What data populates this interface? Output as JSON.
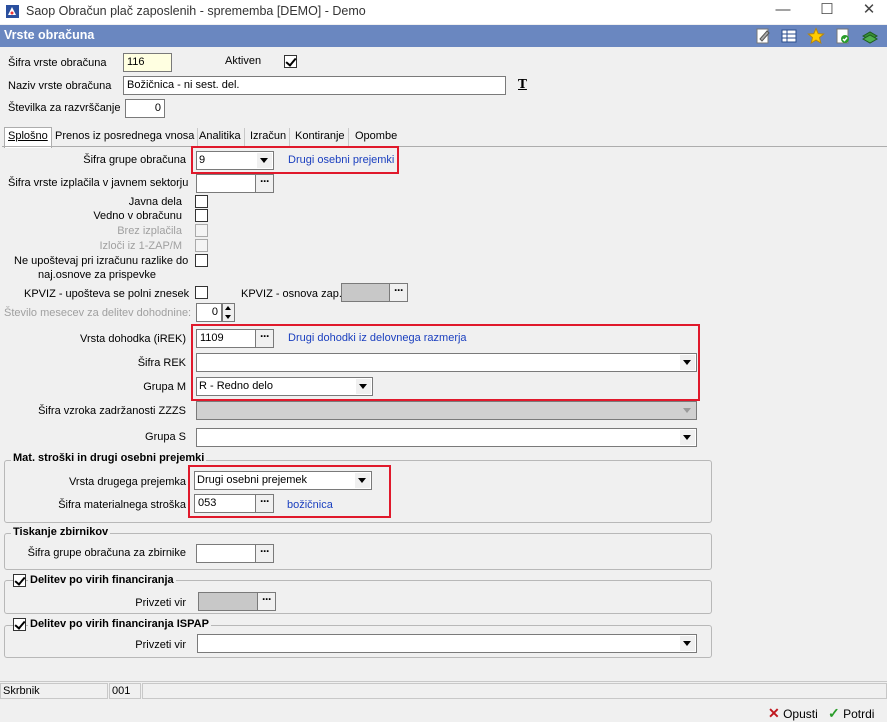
{
  "window": {
    "title": "Saop Obračun plač zaposlenih - sprememba [DEMO] - Demo",
    "min": "—",
    "max": "☐",
    "close": "✕"
  },
  "header": {
    "title": "Vrste obračuna"
  },
  "form": {
    "sifra_label": "Šifra vrste obračuna",
    "sifra_value": "116",
    "aktiven_label": "Aktiven",
    "naziv_label": "Naziv vrste obračuna",
    "naziv_value": "Božičnica - ni sest. del.",
    "stevilka_label": "Številka  za razvrščanje",
    "stevilka_value": "0",
    "font_btn": "T"
  },
  "tabs": [
    {
      "label": "Splošno"
    },
    {
      "label": "Prenos iz posrednega vnosa"
    },
    {
      "label": "Analitika"
    },
    {
      "label": "Izračun"
    },
    {
      "label": "Kontiranje"
    },
    {
      "label": "Opombe"
    }
  ],
  "general": {
    "grupa_label": "Šifra grupe obračuna",
    "grupa_value": "9",
    "grupa_desc": "Drugi osebni prejemki",
    "izplacila_label": "Šifra vrste izplačila v javnem sektorju",
    "javna_dela": "Javna dela",
    "vedno": "Vedno v obračunu",
    "brez": "Brez izplačila",
    "izloci": "Izloči iz 1-ZAP/M",
    "ne_upostevaj_1": "Ne upoštevaj pri izračunu razlike do",
    "ne_upostevaj_2": "naj.osnove za prispevke",
    "kpviz_label": "KPVIZ - upošteva se polni znesek",
    "kpviz_osnova_label": "KPVIZ - osnova zap.",
    "mesecev_label": "Število mesecev za delitev dohodnine:",
    "mesecev_value": "0",
    "dohodek_label": "Vrsta dohodka (iREK)",
    "dohodek_value": "1109",
    "dohodek_desc": "Drugi dohodki iz delovnega razmerja",
    "rek_label": "Šifra REK",
    "rek_value": "",
    "grupa_m_label": "Grupa M",
    "grupa_m_value": "R - Redno delo",
    "zzzs_label": "Šifra vzroka zadržanosti ZZZS",
    "grupa_s_label": "Grupa S",
    "grupa_s_value": ""
  },
  "mat": {
    "title": "Mat. stroški in drugi osebni prejemki",
    "vrsta_label": "Vrsta drugega prejemka",
    "vrsta_value": "Drugi osebni prejemek",
    "sifra_label": "Šifra materialnega stroška",
    "sifra_value": "053",
    "sifra_desc": "božičnica"
  },
  "tisk": {
    "title": "Tiskanje zbirnikov",
    "label": "Šifra grupe obračuna za zbirnike"
  },
  "delitev": {
    "title": "Delitev po virih financiranja",
    "label": "Privzeti vir"
  },
  "delitev_ispap": {
    "title": "Delitev po virih financiranja ISPAP",
    "label": "Privzeti vir"
  },
  "status": {
    "label": "Skrbnik",
    "value": "001"
  },
  "buttons": {
    "cancel": "Opusti",
    "confirm": "Potrdi"
  },
  "colors": {
    "header": "#6a87c0",
    "highlight": "#e0192b",
    "link": "#1a3fbf"
  }
}
